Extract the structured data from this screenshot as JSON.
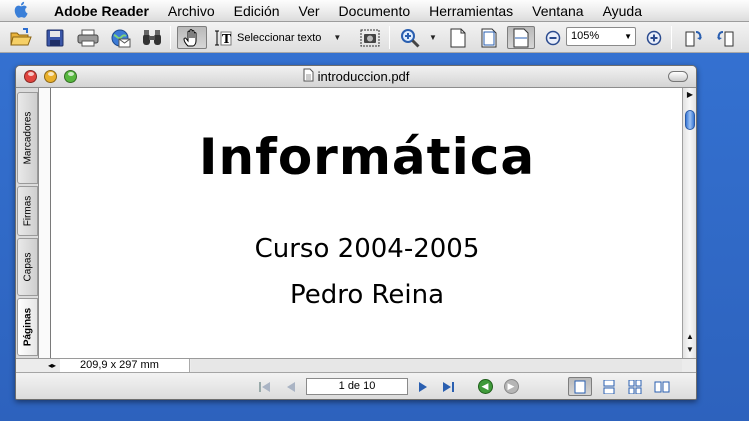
{
  "menubar": {
    "items": [
      "Adobe Reader",
      "Archivo",
      "Edición",
      "Ver",
      "Documento",
      "Herramientas",
      "Ventana",
      "Ayuda"
    ]
  },
  "toolbar": {
    "select_text_label": "Seleccionar texto",
    "zoom_value": "105%"
  },
  "window": {
    "title": "introduccion.pdf"
  },
  "side_tabs": [
    "Marcadores",
    "Firmas",
    "Capas",
    "Páginas"
  ],
  "document": {
    "title": "Informática",
    "course": "Curso 2004-2005",
    "author": "Pedro Reina"
  },
  "status": {
    "page_size": "209,9 x 297 mm"
  },
  "navigation": {
    "page_indicator": "1 de 10"
  },
  "colors": {
    "desktop": "#2f69c9",
    "close": "#e0443e",
    "minimize": "#e9b02b",
    "zoom": "#57b83f",
    "scroll_thumb": "#3a78d6"
  }
}
